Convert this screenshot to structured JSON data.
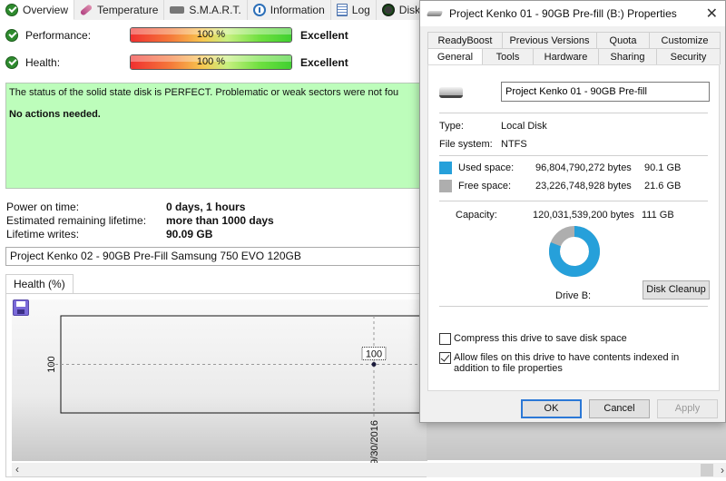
{
  "app": {
    "tabs": [
      {
        "label": "Overview",
        "icon": "check-circle-icon",
        "active": true
      },
      {
        "label": "Temperature",
        "icon": "thermometer-icon",
        "active": false
      },
      {
        "label": "S.M.A.R.T.",
        "icon": "smart-icon",
        "active": false
      },
      {
        "label": "Information",
        "icon": "info-icon",
        "active": false
      },
      {
        "label": "Log",
        "icon": "log-icon",
        "active": false
      },
      {
        "label": "Disk Per",
        "icon": "disk-performance-icon",
        "active": false
      }
    ],
    "performance": {
      "label": "Performance:",
      "value_text": "100 %",
      "percent": 100,
      "rating": "Excellent"
    },
    "health": {
      "label": "Health:",
      "value_text": "100 %",
      "percent": 100,
      "rating": "Excellent"
    },
    "status": {
      "message": "The status of the solid state disk is PERFECT. Problematic or weak sectors were not fou",
      "action": "No actions needed.",
      "color": "#bdfdbb"
    },
    "stats": [
      {
        "key": "Power on time:",
        "value": "0 days, 1 hours"
      },
      {
        "key": "Estimated remaining lifetime:",
        "value": "more than 1000 days"
      },
      {
        "key": "Lifetime writes:",
        "value": "90.09 GB"
      }
    ],
    "device_name": "Project Kenko 02 - 90GB Pre-Fill Samsung 750 EVO 120GB",
    "chart_tab": "Health (%)"
  },
  "chart_data": {
    "type": "line",
    "title": "Health (%)",
    "x": [
      "9/30/2016"
    ],
    "series": [
      {
        "name": "Health",
        "values": [
          100
        ]
      }
    ],
    "ytick_labels": [
      "100"
    ],
    "xtick_labels": [
      "9/30/2016"
    ],
    "point_labels": [
      "100"
    ],
    "grid": true,
    "xlabel": "",
    "ylabel": ""
  },
  "dialog": {
    "title": "Project Kenko 01 - 90GB Pre-fill (B:) Properties",
    "close_label": "✕",
    "tabs_row1": [
      "ReadyBoost",
      "Previous Versions",
      "Quota",
      "Customize"
    ],
    "tabs_row2": [
      "General",
      "Tools",
      "Hardware",
      "Sharing",
      "Security"
    ],
    "active_tab": "General",
    "name_value": "Project Kenko 01 - 90GB Pre-fill",
    "type_label": "Type:",
    "type_value": "Local Disk",
    "fs_label": "File system:",
    "fs_value": "NTFS",
    "used": {
      "label": "Used space:",
      "bytes": "96,804,790,272 bytes",
      "size": "90.1 GB",
      "color": "#26a0da"
    },
    "free": {
      "label": "Free space:",
      "bytes": "23,226,748,928 bytes",
      "size": "21.6 GB",
      "color": "#aeaeae"
    },
    "capacity": {
      "label": "Capacity:",
      "bytes": "120,031,539,200 bytes",
      "size": "111 GB"
    },
    "used_fraction": 0.8065,
    "drive_label": "Drive B:",
    "disk_cleanup": "Disk Cleanup",
    "compress": {
      "label": "Compress this drive to save disk space",
      "checked": false
    },
    "index": {
      "label": "Allow files on this drive to have contents indexed in addition to file properties",
      "checked": true
    },
    "ok": "OK",
    "cancel": "Cancel",
    "apply": "Apply"
  }
}
